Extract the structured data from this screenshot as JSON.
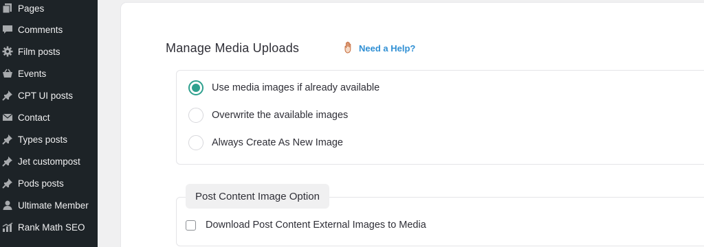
{
  "sidebar": {
    "items": [
      {
        "label": "Pages",
        "icon": "pages-icon"
      },
      {
        "label": "Comments",
        "icon": "comments-icon"
      },
      {
        "label": "Film posts",
        "icon": "gear-icon"
      },
      {
        "label": "Events",
        "icon": "basket-icon"
      },
      {
        "label": "CPT UI posts",
        "icon": "pin-icon"
      },
      {
        "label": "Contact",
        "icon": "envelope-icon"
      },
      {
        "label": "Types posts",
        "icon": "pin-icon"
      },
      {
        "label": "Jet custompost",
        "icon": "pin-icon"
      },
      {
        "label": "Pods posts",
        "icon": "pin-icon"
      },
      {
        "label": "Ultimate Member",
        "icon": "user-icon"
      },
      {
        "label": "Rank Math SEO",
        "icon": "chart-icon"
      }
    ]
  },
  "main": {
    "title": "Manage Media Uploads",
    "help_label": "Need a Help?",
    "options": [
      {
        "label": "Use media images if already available",
        "checked": true
      },
      {
        "label": "Overwrite the available images",
        "checked": false
      },
      {
        "label": "Always Create As New Image",
        "checked": false
      }
    ],
    "post_content_section": {
      "title": "Post Content Image Option",
      "checkbox_label": "Download Post Content External Images to Media",
      "checked": false
    }
  },
  "colors": {
    "sidebar_bg": "#1d2327",
    "accent": "#2ea08e",
    "link": "#2f8fd4"
  }
}
